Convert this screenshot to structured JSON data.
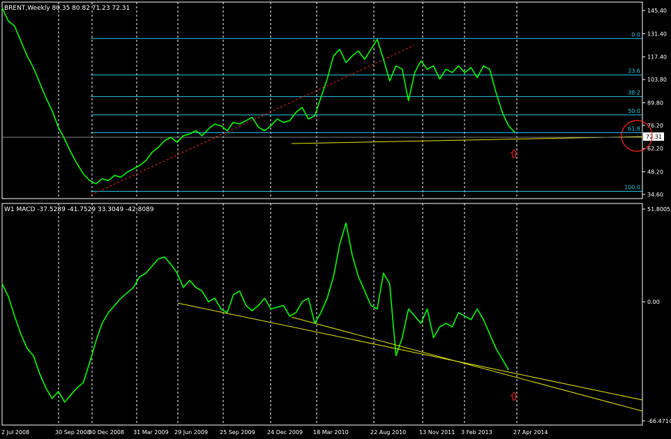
{
  "price_panel": {
    "header": "BRENT,Weekly  80.35 80.82 71.23 72.31",
    "y_ticks": [
      "145.40",
      "131.40",
      "117.40",
      "103.80",
      "89.80",
      "76.20",
      "62.20",
      "48.20",
      "34.60"
    ],
    "current_price": "72.31",
    "fib_labels": [
      "0.0",
      "23.6",
      "38.2",
      "50.0",
      "61.8",
      "100.0"
    ]
  },
  "macd_panel": {
    "header": "W1 MACD -37.5289 -41.7529 33.3049 -42.8089",
    "y_ticks": [
      "51.8005",
      "0.00",
      "-66.4714"
    ]
  },
  "x_ticks": [
    "2 Jul 2008",
    "30 Sep 2008",
    "30 Dec 2008",
    "31 Mar 2009",
    "29 Jun 2009",
    "25 Sep 2009",
    "24 Dec 2009",
    "18 Mar 2010",
    "22 Aug 2010",
    "13 Nov 2011",
    "3 Feb 2013",
    "27 Apr 2014"
  ],
  "colors": {
    "background": "#000000",
    "price_line": "#00ff00",
    "fib_lines": "#28c8e8",
    "trendlines": "#e8e800",
    "fib_connector": "#ff2020",
    "signal_arrow": "#ff2020",
    "grid_vertical": "#ffffff",
    "axis_text": "#ffffff"
  },
  "chart_data": [
    {
      "type": "line",
      "name": "BRENT Weekly price",
      "ylim": [
        34.6,
        145.4
      ],
      "x": [
        "2 Jul 2008",
        "30 Sep 2008",
        "30 Dec 2008",
        "31 Mar 2009",
        "29 Jun 2009",
        "25 Sep 2009",
        "24 Dec 2009",
        "18 Mar 2010",
        "22 Aug 2010",
        "13 Nov 2011",
        "3 Feb 2013",
        "27 Apr 2014"
      ],
      "series": [
        {
          "values": [
            145,
            102,
            38,
            48,
            62,
            75,
            78,
            82,
            80,
            122,
            112,
            104,
            110,
            72
          ]
        }
      ],
      "price_path": [
        [
          0,
          147
        ],
        [
          2,
          139
        ],
        [
          4,
          136
        ],
        [
          6,
          127
        ],
        [
          8,
          118
        ],
        [
          10,
          111
        ],
        [
          12,
          102
        ],
        [
          14,
          93
        ],
        [
          16,
          85
        ],
        [
          18,
          75
        ],
        [
          20,
          68
        ],
        [
          22,
          60
        ],
        [
          24,
          53
        ],
        [
          26,
          47
        ],
        [
          28,
          43
        ],
        [
          30,
          41
        ],
        [
          32,
          44
        ],
        [
          34,
          43
        ],
        [
          36,
          46
        ],
        [
          38,
          45
        ],
        [
          40,
          48
        ],
        [
          42,
          50
        ],
        [
          44,
          52
        ],
        [
          46,
          55
        ],
        [
          48,
          60
        ],
        [
          50,
          63
        ],
        [
          52,
          67
        ],
        [
          54,
          69
        ],
        [
          56,
          66
        ],
        [
          58,
          70
        ],
        [
          60,
          71
        ],
        [
          62,
          73
        ],
        [
          64,
          70
        ],
        [
          66,
          74
        ],
        [
          68,
          77
        ],
        [
          70,
          76
        ],
        [
          72,
          73
        ],
        [
          74,
          78
        ],
        [
          76,
          77
        ],
        [
          78,
          79
        ],
        [
          80,
          81
        ],
        [
          82,
          75
        ],
        [
          84,
          73
        ],
        [
          86,
          76
        ],
        [
          88,
          80
        ],
        [
          90,
          78
        ],
        [
          92,
          79
        ],
        [
          94,
          84
        ],
        [
          96,
          87
        ],
        [
          98,
          80
        ],
        [
          100,
          82
        ],
        [
          102,
          93
        ],
        [
          104,
          104
        ],
        [
          106,
          118
        ],
        [
          108,
          122
        ],
        [
          110,
          114
        ],
        [
          112,
          118
        ],
        [
          114,
          121
        ],
        [
          116,
          116
        ],
        [
          118,
          122
        ],
        [
          120,
          128
        ],
        [
          122,
          116
        ],
        [
          124,
          103
        ],
        [
          126,
          112
        ],
        [
          128,
          110
        ],
        [
          130,
          91
        ],
        [
          132,
          108
        ],
        [
          134,
          115
        ],
        [
          136,
          110
        ],
        [
          138,
          112
        ],
        [
          140,
          104
        ],
        [
          142,
          110
        ],
        [
          144,
          108
        ],
        [
          146,
          112
        ],
        [
          148,
          108
        ],
        [
          150,
          111
        ],
        [
          152,
          105
        ],
        [
          154,
          112
        ],
        [
          156,
          110
        ],
        [
          158,
          96
        ],
        [
          160,
          84
        ],
        [
          162,
          76
        ],
        [
          164,
          72
        ]
      ],
      "fibonacci_levels": [
        {
          "label": "0.0",
          "value": 128.5
        },
        {
          "label": "23.6",
          "value": 106.5
        },
        {
          "label": "38.2",
          "value": 93.5
        },
        {
          "label": "50.0",
          "value": 82.5
        },
        {
          "label": "61.8",
          "value": 71.8
        },
        {
          "label": "100.0",
          "value": 36.5
        }
      ]
    },
    {
      "type": "line",
      "name": "W1 MACD",
      "ylim": [
        -66.4714,
        51.8005
      ],
      "series": [
        {
          "values": [
            10,
            -55,
            -30,
            8,
            2,
            -1,
            -2,
            0,
            -5,
            44,
            8,
            -4,
            4,
            -38
          ]
        }
      ],
      "macd_path": [
        [
          0,
          10
        ],
        [
          2,
          3
        ],
        [
          4,
          -8
        ],
        [
          6,
          -18
        ],
        [
          8,
          -26
        ],
        [
          10,
          -30
        ],
        [
          12,
          -40
        ],
        [
          14,
          -48
        ],
        [
          16,
          -54
        ],
        [
          18,
          -50
        ],
        [
          20,
          -56
        ],
        [
          22,
          -52
        ],
        [
          24,
          -48
        ],
        [
          26,
          -45
        ],
        [
          28,
          -34
        ],
        [
          30,
          -22
        ],
        [
          32,
          -12
        ],
        [
          34,
          -6
        ],
        [
          36,
          -2
        ],
        [
          38,
          2
        ],
        [
          40,
          5
        ],
        [
          42,
          8
        ],
        [
          44,
          14
        ],
        [
          46,
          16
        ],
        [
          48,
          20
        ],
        [
          50,
          24
        ],
        [
          52,
          25
        ],
        [
          54,
          21
        ],
        [
          56,
          16
        ],
        [
          58,
          8
        ],
        [
          60,
          12
        ],
        [
          62,
          8
        ],
        [
          64,
          6
        ],
        [
          66,
          0
        ],
        [
          68,
          2
        ],
        [
          70,
          -4
        ],
        [
          72,
          -6
        ],
        [
          74,
          4
        ],
        [
          76,
          6
        ],
        [
          78,
          -2
        ],
        [
          80,
          -5
        ],
        [
          82,
          -2
        ],
        [
          84,
          2
        ],
        [
          86,
          -4
        ],
        [
          88,
          -3
        ],
        [
          90,
          -2
        ],
        [
          92,
          -8
        ],
        [
          94,
          -6
        ],
        [
          96,
          0
        ],
        [
          98,
          2
        ],
        [
          100,
          -12
        ],
        [
          102,
          -6
        ],
        [
          104,
          2
        ],
        [
          106,
          14
        ],
        [
          108,
          32
        ],
        [
          110,
          44
        ],
        [
          112,
          26
        ],
        [
          114,
          14
        ],
        [
          116,
          6
        ],
        [
          118,
          -2
        ],
        [
          120,
          -4
        ],
        [
          122,
          16
        ],
        [
          124,
          10
        ],
        [
          126,
          -30
        ],
        [
          128,
          -20
        ],
        [
          130,
          -4
        ],
        [
          132,
          -8
        ],
        [
          134,
          -12
        ],
        [
          136,
          -4
        ],
        [
          138,
          -20
        ],
        [
          140,
          -14
        ],
        [
          142,
          -12
        ],
        [
          144,
          -14
        ],
        [
          146,
          -6
        ],
        [
          148,
          -8
        ],
        [
          150,
          -10
        ],
        [
          152,
          -4
        ],
        [
          154,
          -10
        ],
        [
          156,
          -18
        ],
        [
          158,
          -26
        ],
        [
          160,
          -32
        ],
        [
          162,
          -38
        ]
      ]
    }
  ]
}
